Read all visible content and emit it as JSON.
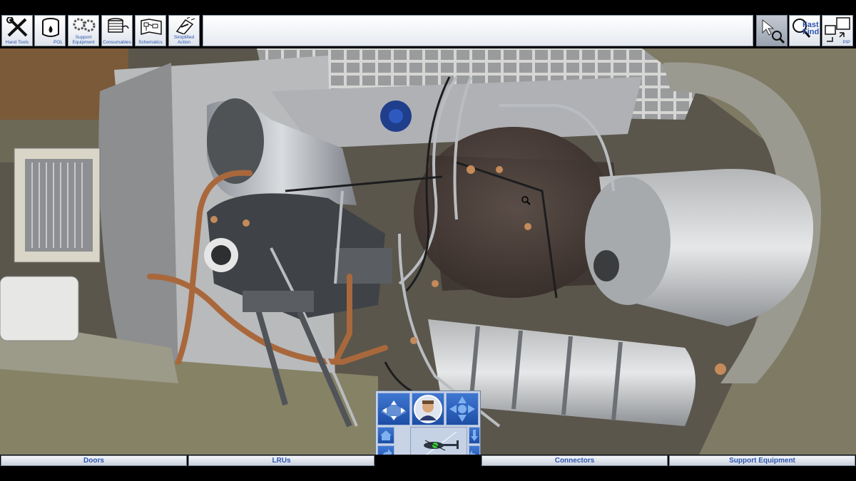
{
  "toolbar": {
    "items": [
      {
        "label": "Hand Tools",
        "icon": "hand-tools-icon"
      },
      {
        "label": "POL",
        "icon": "pol-icon"
      },
      {
        "label": "Support\nEquipment",
        "icon": "support-equipment-icon"
      },
      {
        "label": "Consumables",
        "icon": "consumables-icon"
      },
      {
        "label": "Schematics",
        "icon": "schematics-icon"
      },
      {
        "label": "Simplified\nAction",
        "icon": "simplified-action-icon"
      }
    ],
    "title": "",
    "fast_find": "Fast\nFind",
    "pip": "PIP"
  },
  "bottom_tabs": [
    "Doors",
    "LRUs",
    "Connectors",
    "Support Equipment"
  ],
  "colors": {
    "accent": "#2a55b0",
    "button_blue": "#1d4ea6",
    "engine_brown": "#4a3f3a",
    "hull": "#6e6c5e"
  }
}
